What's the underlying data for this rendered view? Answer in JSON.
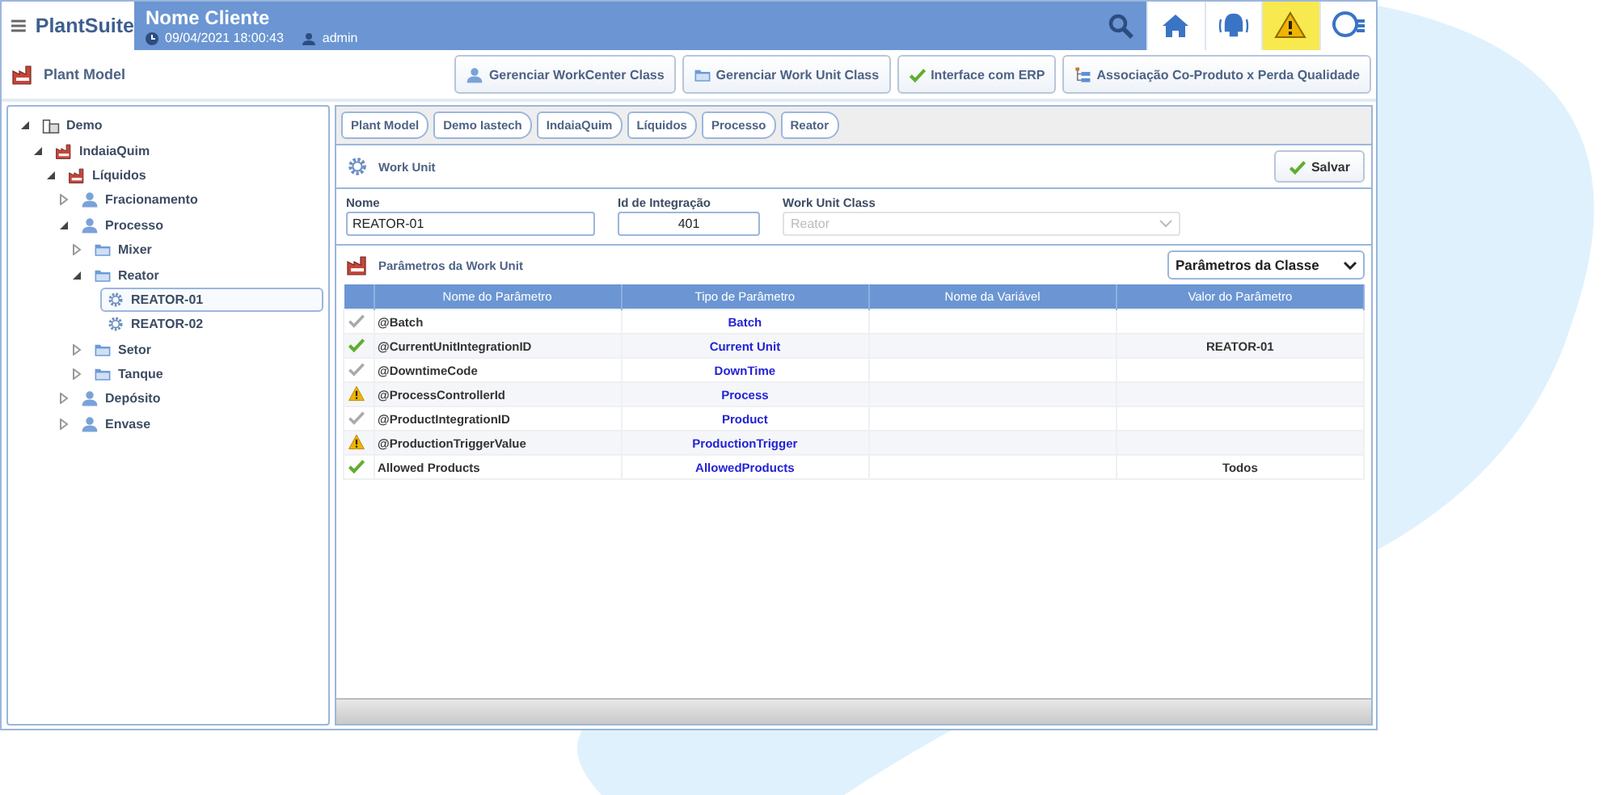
{
  "header": {
    "brand": "PlantSuite",
    "client": "Nome Cliente",
    "datetime": "09/04/2021 18:00:43",
    "user": "admin",
    "nav": [
      {
        "kind": "home",
        "selected": false
      },
      {
        "kind": "alarm",
        "selected": false
      },
      {
        "kind": "warning",
        "selected": true
      },
      {
        "kind": "user",
        "selected": false
      }
    ]
  },
  "toolbar": {
    "title": "Plant Model",
    "buttons": [
      {
        "kind": "user",
        "label": "Gerenciar WorkCenter Class"
      },
      {
        "kind": "folder",
        "label": "Gerenciar Work Unit Class"
      },
      {
        "kind": "check",
        "label": "Interface com ERP"
      },
      {
        "kind": "tree",
        "label": "Associação Co-Produto x Perda Qualidade"
      }
    ]
  },
  "tree": [
    {
      "label": "Demo",
      "kind": "building",
      "expanded": true,
      "selected": false,
      "children": [
        {
          "label": "IndaiaQuim",
          "kind": "factory",
          "expanded": true,
          "selected": false,
          "children": [
            {
              "label": "Líquidos",
              "kind": "factory",
              "expanded": true,
              "selected": false,
              "children": [
                {
                  "label": "Fracionamento",
                  "kind": "user",
                  "expanded": false,
                  "selected": false
                },
                {
                  "label": "Processo",
                  "kind": "user",
                  "expanded": true,
                  "selected": false,
                  "children": [
                    {
                      "label": "Mixer",
                      "kind": "folder",
                      "expanded": false,
                      "selected": false
                    },
                    {
                      "label": "Reator",
                      "kind": "folder",
                      "expanded": true,
                      "selected": false,
                      "children": [
                        {
                          "label": "REATOR-01",
                          "kind": "gear",
                          "selected": true
                        },
                        {
                          "label": "REATOR-02",
                          "kind": "gear",
                          "selected": false
                        }
                      ]
                    },
                    {
                      "label": "Setor",
                      "kind": "folder",
                      "expanded": false,
                      "selected": false
                    },
                    {
                      "label": "Tanque",
                      "kind": "folder",
                      "expanded": false,
                      "selected": false
                    }
                  ]
                },
                {
                  "label": "Depósito",
                  "kind": "user",
                  "expanded": false,
                  "selected": false
                },
                {
                  "label": "Envase",
                  "kind": "user",
                  "expanded": false,
                  "selected": false
                }
              ]
            }
          ]
        }
      ]
    }
  ],
  "breadcrumbs": [
    "Plant Model",
    "Demo Iastech",
    "IndaiaQuim",
    "Líquidos",
    "Processo",
    "Reator"
  ],
  "work_unit": {
    "title": "Work Unit",
    "save_button": "Salvar",
    "fields": [
      {
        "label": "Nome",
        "value": "REATOR-01",
        "kind": "text",
        "disabled": false
      },
      {
        "label": "Id de Integração",
        "value": "401",
        "kind": "number",
        "disabled": false
      },
      {
        "label": "Work Unit Class",
        "value": "Reator",
        "kind": "select",
        "disabled": true
      }
    ]
  },
  "parameters": {
    "title": "Parâmetros da Work Unit",
    "filter": "Parâmetros da Classe",
    "columns": [
      "Nome do Parâmetro",
      "Tipo de Parâmetro",
      "Nome da Variável",
      "Valor do Parâmetro"
    ],
    "rows": [
      {
        "kind": "check-muted",
        "name": "@Batch",
        "type": "Batch"
      },
      {
        "kind": "check",
        "name": "@CurrentUnitIntegrationID",
        "type": "Current Unit",
        "value": "REATOR-01"
      },
      {
        "kind": "check-muted",
        "name": "@DowntimeCode",
        "type": "DownTime"
      },
      {
        "kind": "warning",
        "name": "@ProcessControllerId",
        "type": "Process"
      },
      {
        "kind": "check-muted",
        "name": "@ProductIntegrationID",
        "type": "Product"
      },
      {
        "kind": "warning",
        "name": "@ProductionTriggerValue",
        "type": "ProductionTrigger"
      },
      {
        "kind": "check",
        "name": "Allowed Products",
        "type": "AllowedProducts",
        "value": "Todos"
      }
    ]
  }
}
